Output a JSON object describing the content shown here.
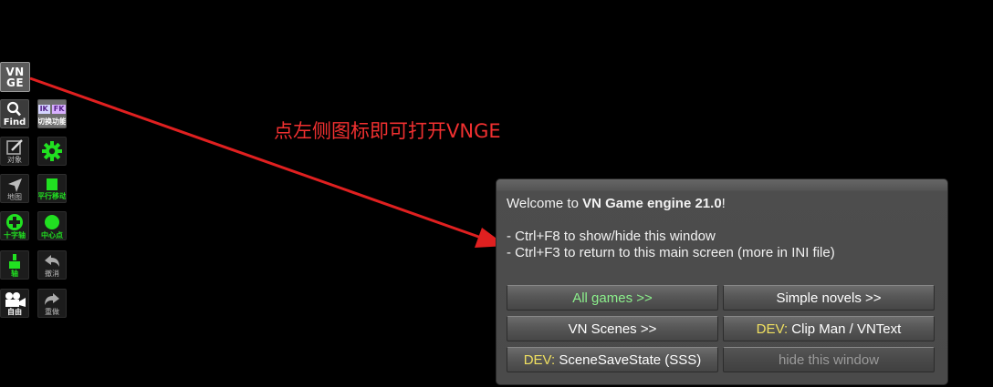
{
  "toolbar": {
    "vnge": {
      "line1": "VN",
      "line2": "GE"
    },
    "find": {
      "label": "Find"
    },
    "ikfk": {
      "ik": "IK",
      "fk": "FK",
      "label": "切换功能"
    },
    "object": {
      "label": "对象"
    },
    "map": {
      "label": "地图"
    },
    "translate": {
      "label": "平行移动"
    },
    "add_axis": {
      "label": "十字轴"
    },
    "center": {
      "label": "中心点"
    },
    "axis": {
      "label": "轴"
    },
    "undo": {
      "label": "撤消"
    },
    "camera": {
      "label": "自由"
    },
    "redo": {
      "label": "重做"
    }
  },
  "annotation": {
    "text": "点左侧图标即可打开VNGE"
  },
  "panel": {
    "welcome_prefix": "Welcome to ",
    "welcome_bold": "VN Game engine 21.0",
    "welcome_suffix": "!",
    "line2": "- Ctrl+F8 to show/hide this window",
    "line3": "- Ctrl+F3 to return to this main screen (more in INI file)",
    "buttons": {
      "all_games": "All games >>",
      "simple_novels": "Simple novels >>",
      "vn_scenes": "VN Scenes >>",
      "dev_prefix": "DEV:",
      "clip_man": " Clip Man / VNText",
      "scene_save_state": " SceneSaveState (SSS)",
      "hide_window": "hide this window"
    }
  },
  "colors": {
    "annotation": "#f03030",
    "accent_green": "#21e021",
    "dev_yellow": "#f0e060",
    "all_games_green": "#8cf08c"
  },
  "icons": [
    "magnifier-icon",
    "pencil-icon",
    "gear-icon",
    "map-arrow-icon",
    "move-icon",
    "plus-icon",
    "center-dot-icon",
    "axis-icon",
    "undo-icon",
    "camera-icon",
    "redo-icon"
  ]
}
